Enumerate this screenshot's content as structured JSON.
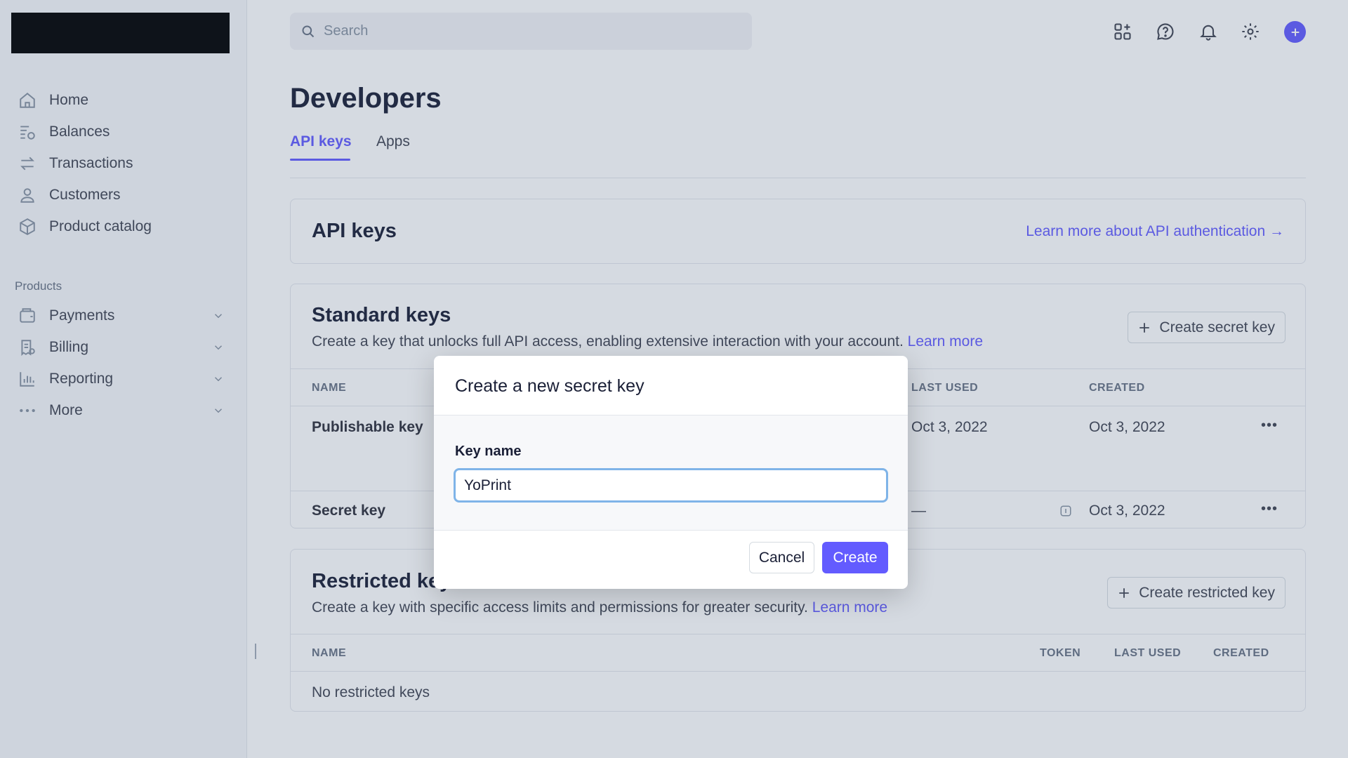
{
  "search": {
    "placeholder": "Search"
  },
  "sidebar": {
    "items": [
      {
        "label": "Home",
        "icon": "home-icon"
      },
      {
        "label": "Balances",
        "icon": "balances-icon"
      },
      {
        "label": "Transactions",
        "icon": "transactions-icon"
      },
      {
        "label": "Customers",
        "icon": "customers-icon"
      },
      {
        "label": "Product catalog",
        "icon": "product-catalog-icon"
      }
    ],
    "section_label": "Products",
    "products": [
      {
        "label": "Payments",
        "icon": "payments-icon"
      },
      {
        "label": "Billing",
        "icon": "billing-icon"
      },
      {
        "label": "Reporting",
        "icon": "reporting-icon"
      },
      {
        "label": "More",
        "icon": "more-icon"
      }
    ]
  },
  "page": {
    "title": "Developers",
    "tabs": [
      {
        "label": "API keys",
        "active": true
      },
      {
        "label": "Apps",
        "active": false
      }
    ]
  },
  "api_keys_card": {
    "title": "API keys",
    "learn_more": "Learn more about API authentication →"
  },
  "standard_keys": {
    "title": "Standard keys",
    "description": "Create a key that unlocks full API access, enabling extensive interaction with your account.",
    "learn_more": "Learn more",
    "create_button": "Create secret key",
    "columns": {
      "name": "NAME",
      "last_used": "LAST USED",
      "created": "CREATED"
    },
    "rows": [
      {
        "name": "Publishable key",
        "last_used": "Oct 3, 2022",
        "created": "Oct 3, 2022"
      },
      {
        "name": "Secret key",
        "last_used": "—",
        "created": "Oct 3, 2022"
      }
    ]
  },
  "restricted_keys": {
    "title": "Restricted keys",
    "description": "Create a key with specific access limits and permissions for greater security.",
    "learn_more": "Learn more",
    "create_button": "Create restricted key",
    "columns": {
      "name": "NAME",
      "token": "TOKEN",
      "last_used": "LAST USED",
      "created": "CREATED"
    },
    "empty": "No restricted keys"
  },
  "modal": {
    "title": "Create a new secret key",
    "field_label": "Key name",
    "field_value": "YoPrint",
    "cancel": "Cancel",
    "create": "Create"
  },
  "colors": {
    "accent": "#635bff",
    "focus_ring": "#7fb4e8"
  }
}
